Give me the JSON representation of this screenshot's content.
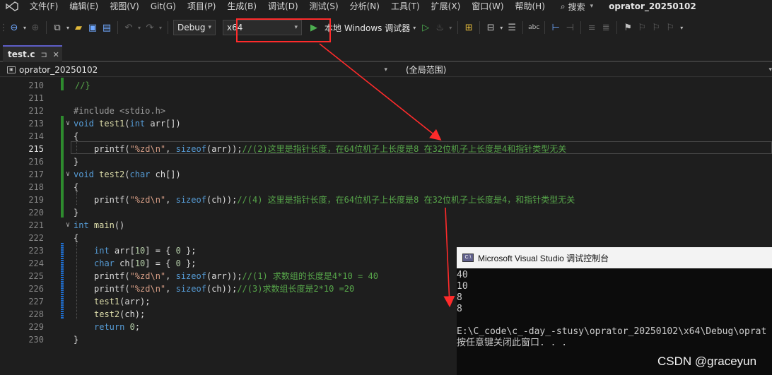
{
  "menu": {
    "items": [
      "文件(F)",
      "编辑(E)",
      "视图(V)",
      "Git(G)",
      "项目(P)",
      "生成(B)",
      "调试(D)",
      "测试(S)",
      "分析(N)",
      "工具(T)",
      "扩展(X)",
      "窗口(W)",
      "帮助(H)"
    ],
    "search_label": "搜索",
    "window_title": "oprator_20250102"
  },
  "toolbar": {
    "configuration": "Debug",
    "platform": "x64",
    "run_label": "本地 Windows 调试器"
  },
  "tabs": [
    {
      "label": "test.c",
      "pin": "⊐",
      "close": "✕"
    }
  ],
  "nav": {
    "project": "oprator_20250102",
    "scope": "(全局范围)"
  },
  "editor": {
    "lines": [
      {
        "n": "210",
        "text": "//}"
      },
      {
        "n": "211",
        "text": ""
      },
      {
        "n": "212",
        "text": "#include <stdio.h>"
      },
      {
        "n": "213",
        "text": "void test1(int arr[])"
      },
      {
        "n": "214",
        "text": "{"
      },
      {
        "n": "215",
        "text": "printf(\"%zd\\n\", sizeof(arr));//(2)这里是指针长度，在64位机子上长度是8 在32位机子上长度是4和指针类型无关"
      },
      {
        "n": "216",
        "text": "}"
      },
      {
        "n": "217",
        "text": "void test2(char ch[])"
      },
      {
        "n": "218",
        "text": "{"
      },
      {
        "n": "219",
        "text": "printf(\"%zd\\n\", sizeof(ch));//(4) 这里是指针长度，在64位机子上长度是8 在32位机子上长度是4，和指针类型无关"
      },
      {
        "n": "220",
        "text": "}"
      },
      {
        "n": "221",
        "text": "int main()"
      },
      {
        "n": "222",
        "text": "{"
      },
      {
        "n": "223",
        "text": "int arr[10] = { 0 };"
      },
      {
        "n": "224",
        "text": "char ch[10] = { 0 };"
      },
      {
        "n": "225",
        "text": "printf(\"%zd\\n\", sizeof(arr));//(1) 求数组的长度是4*10 = 40"
      },
      {
        "n": "226",
        "text": "printf(\"%zd\\n\", sizeof(ch));//(3)求数组长度是2*10 =20"
      },
      {
        "n": "227",
        "text": "test1(arr);"
      },
      {
        "n": "228",
        "text": "test2(ch);"
      },
      {
        "n": "229",
        "text": "return 0;"
      },
      {
        "n": "230",
        "text": "}"
      }
    ],
    "current_line": "215"
  },
  "console": {
    "title": "Microsoft Visual Studio 调试控制台",
    "icon_text": "C:\\",
    "output": [
      "40",
      "10",
      "8",
      "8",
      "",
      "E:\\C_code\\c_-day_-stusy\\oprator_20250102\\x64\\Debug\\oprat",
      "按任意键关闭此窗口. . ."
    ]
  },
  "watermark": "CSDN @graceyun",
  "colors": {
    "highlight": "#ff2b2b",
    "keyword": "#569cd6",
    "comment": "#57a64a",
    "string": "#d69d85",
    "change_bar_saved": "#2e8b2e",
    "change_bar_unsaved": "#1f6fd1"
  }
}
